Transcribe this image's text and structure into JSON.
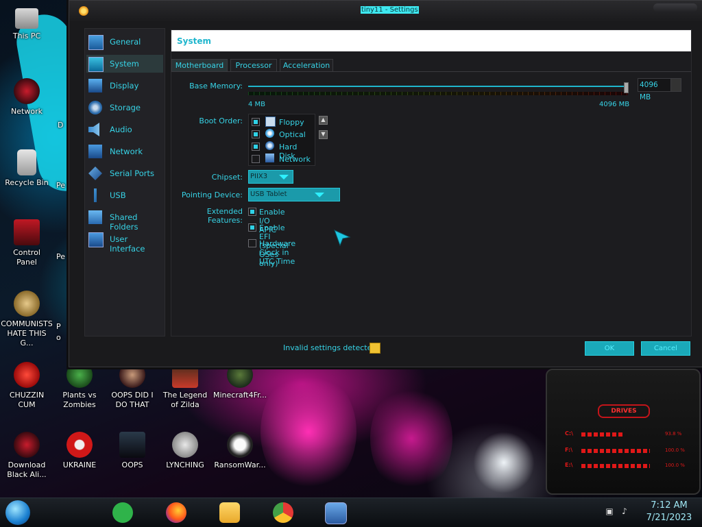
{
  "window": {
    "title": "tiny11 - Settings"
  },
  "sidebar": {
    "items": [
      {
        "label": "General",
        "icon": "general-icon",
        "selected": false
      },
      {
        "label": "System",
        "icon": "system-icon",
        "selected": true
      },
      {
        "label": "Display",
        "icon": "display-icon",
        "selected": false
      },
      {
        "label": "Storage",
        "icon": "storage-icon",
        "selected": false
      },
      {
        "label": "Audio",
        "icon": "audio-icon",
        "selected": false
      },
      {
        "label": "Network",
        "icon": "network-icon",
        "selected": false
      },
      {
        "label": "Serial Ports",
        "icon": "serial-ports-icon",
        "selected": false
      },
      {
        "label": "USB",
        "icon": "usb-icon",
        "selected": false
      },
      {
        "label": "Shared Folders",
        "icon": "shared-folders-icon",
        "selected": false
      },
      {
        "label": "User Interface",
        "icon": "user-interface-icon",
        "selected": false
      }
    ]
  },
  "page": {
    "header": "System"
  },
  "tabs": [
    {
      "label": "Motherboard",
      "selected": true
    },
    {
      "label": "Processor",
      "selected": false
    },
    {
      "label": "Acceleration",
      "selected": false
    }
  ],
  "motherboard": {
    "base_memory_label": "Base Memory:",
    "base_memory_value": "4096 MB",
    "memory_min_label": "4 MB",
    "memory_max_label": "4096 MB",
    "memory_level": 1.0,
    "boot_order_label": "Boot Order:",
    "boot_order": [
      {
        "label": "Floppy",
        "checked": true,
        "icon": "floppy-icon"
      },
      {
        "label": "Optical",
        "checked": true,
        "icon": "optical-disc-icon"
      },
      {
        "label": "Hard Disk",
        "checked": true,
        "icon": "hard-disk-icon"
      },
      {
        "label": "Network",
        "checked": false,
        "icon": "network-icon"
      }
    ],
    "chipset_label": "Chipset:",
    "chipset_value": "PIIX3",
    "pointing_label": "Pointing Device:",
    "pointing_value": "USB Tablet",
    "extended_label": "Extended Features:",
    "features": [
      {
        "label": "Enable I/O APIC",
        "checked": true
      },
      {
        "label": "Enable EFI (special OSes only)",
        "checked": true
      },
      {
        "label": "Hardware Clock in UTC Time",
        "checked": false
      }
    ]
  },
  "footer": {
    "warning": "Invalid settings detected",
    "ok": "OK",
    "cancel": "Cancel"
  },
  "desktop": {
    "icons": [
      {
        "label": "This PC"
      },
      {
        "label": "Network"
      },
      {
        "label": "Recycle Bin"
      },
      {
        "label": "Control Panel"
      },
      {
        "label": "COMMUNISTS HATE THIS G..."
      },
      {
        "label": "CHUZZIN CUM"
      },
      {
        "label": "Plants vs Zombies"
      },
      {
        "label": "OOPS DID I DO THAT"
      },
      {
        "label": "The Legend of Zilda"
      },
      {
        "label": "Minecraft4Fr..."
      },
      {
        "label": "Download Black Ali..."
      },
      {
        "label": "UKRAINE"
      },
      {
        "label": "OOPS"
      },
      {
        "label": "LYNCHING"
      },
      {
        "label": "RansomWar..."
      }
    ],
    "partial_labels": [
      "D",
      "Pe",
      "Pe",
      "P",
      "o"
    ]
  },
  "gadget": {
    "title": "DRIVES",
    "drives": [
      {
        "letter": "C:\\",
        "value": "93.8 %",
        "level": 0.6
      },
      {
        "letter": "F:\\",
        "value": "100.0 %",
        "level": 1.0
      },
      {
        "letter": "E:\\",
        "value": "100.0 %",
        "level": 1.0
      }
    ]
  },
  "taskbar": {
    "time": "7:12 AM",
    "date": "7/21/2023",
    "pinned": [
      "speech-app-icon",
      "firefox-icon",
      "file-explorer-icon",
      "chrome-icon",
      "virtualbox-icon"
    ]
  },
  "colors": {
    "accent": "#2fd1e6",
    "window_bg": "#1a1a1c",
    "warning": "#f1c232"
  }
}
